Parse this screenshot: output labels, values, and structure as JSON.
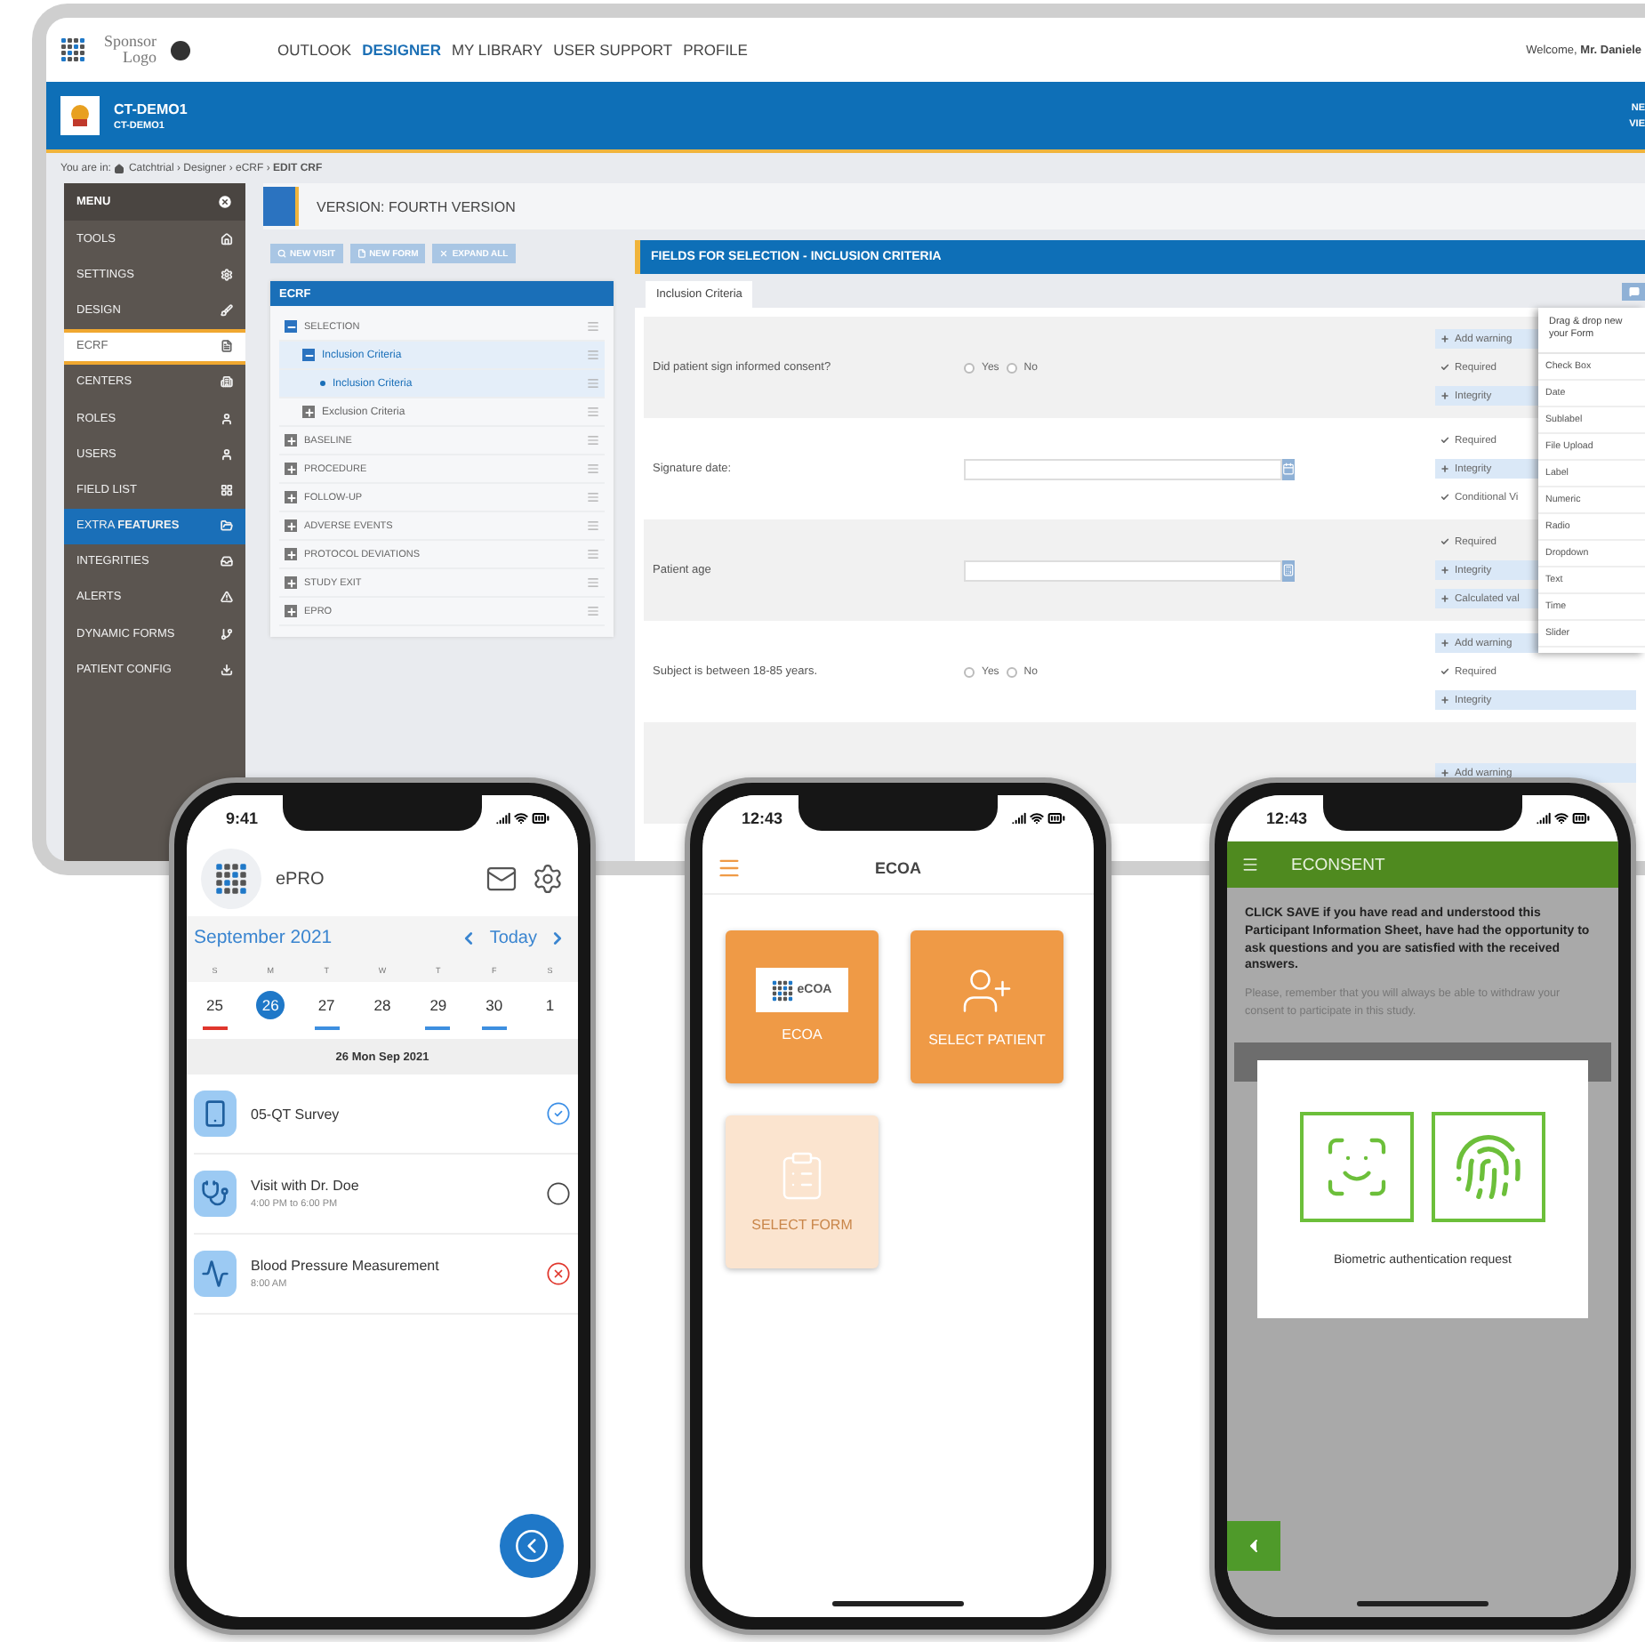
{
  "monitor": {
    "topnav": {
      "logo": "Sponsor Logo",
      "links": [
        {
          "label": "OUTLOOK",
          "selected": false
        },
        {
          "label": "DESIGNER",
          "selected": true
        },
        {
          "label": "MY LIBRARY",
          "selected": false
        },
        {
          "label": "USER SUPPORT",
          "selected": false
        },
        {
          "label": "PROFILE",
          "selected": false
        }
      ],
      "welcome": "Welcome, **Mr. Daniele**"
    },
    "study_bar": {
      "title": "CT-DEMO1",
      "subtitle": "CT-DEMO1",
      "links": [
        "NE",
        "VIE"
      ]
    },
    "breadcrumb": {
      "prefix": "You are in:",
      "path": "Catchtrial › Designer › eCRF › **EDIT CRF**"
    },
    "sidebar": {
      "title": "MENU",
      "items": [
        {
          "label": "TOOLS",
          "selected": false,
          "highlighted": false
        },
        {
          "label": "SETTINGS",
          "selected": false,
          "highlighted": false
        },
        {
          "label": "DESIGN",
          "selected": false,
          "highlighted": false
        },
        {
          "label": "ECRF",
          "selected": true,
          "highlighted": false
        },
        {
          "label": "CENTERS",
          "selected": false,
          "highlighted": false
        },
        {
          "label": "ROLES",
          "selected": false,
          "highlighted": false
        },
        {
          "label": "USERS",
          "selected": false,
          "highlighted": false
        },
        {
          "label": "FIELD LIST",
          "selected": false,
          "highlighted": false
        },
        {
          "label": "EXTRA **FEATURES**",
          "selected": false,
          "highlighted": true
        },
        {
          "label": "INTEGRITIES",
          "selected": false,
          "highlighted": false
        },
        {
          "label": "ALERTS",
          "selected": false,
          "highlighted": false
        },
        {
          "label": "DYNAMIC FORMS",
          "selected": false,
          "highlighted": false
        },
        {
          "label": "PATIENT CONFIG",
          "selected": false,
          "highlighted": false
        }
      ]
    },
    "version": "VERSION: FOURTH VERSION",
    "toolbar": [
      "NEW VISIT",
      "NEW FORM",
      "EXPAND ALL"
    ],
    "tree": {
      "title": "ECRF",
      "nodes": [
        {
          "label": "SELECTION",
          "expanded": true,
          "selected": false,
          "children": [
            {
              "label": "Inclusion Criteria",
              "expanded": true,
              "selected": true,
              "children": [
                {
                  "label": "Inclusion Criteria",
                  "selected": true
                }
              ]
            },
            {
              "label": "Exclusion Criteria",
              "expanded": false,
              "selected": false
            }
          ]
        },
        {
          "label": "BASELINE",
          "expanded": false,
          "selected": false
        },
        {
          "label": "PROCEDURE",
          "expanded": false,
          "selected": false
        },
        {
          "label": "FOLLOW-UP",
          "expanded": false,
          "selected": false
        },
        {
          "label": "ADVERSE EVENTS",
          "expanded": false,
          "selected": false
        },
        {
          "label": "PROTOCOL DEVIATIONS",
          "expanded": false,
          "selected": false
        },
        {
          "label": "STUDY EXIT",
          "expanded": false,
          "selected": false
        },
        {
          "label": "EPRO",
          "expanded": false,
          "selected": false
        }
      ]
    },
    "fields": {
      "title": "FIELDS FOR SELECTION - INCLUSION CRITERIA",
      "tabs": [
        {
          "label": "Inclusion Criteria",
          "selected": true
        }
      ],
      "rows": [
        {
          "label": "Did patient sign informed consent?",
          "control": {
            "kind": "radio",
            "options": [
              {
                "label": "Yes",
                "selected": false
              },
              {
                "label": "No",
                "selected": false
              }
            ]
          },
          "actions": [
            {
              "kind": "add",
              "label": "Add warning"
            },
            {
              "kind": "check",
              "label": "Required"
            },
            {
              "kind": "add",
              "label": "Integrity"
            }
          ]
        },
        {
          "label": "Signature date:",
          "control": {
            "kind": "date"
          },
          "actions": [
            {
              "kind": "check",
              "label": "Required"
            },
            {
              "kind": "add",
              "label": "Integrity"
            },
            {
              "kind": "check",
              "label": "Conditional Vi"
            }
          ]
        },
        {
          "label": "Patient age",
          "control": {
            "kind": "calculated"
          },
          "actions": [
            {
              "kind": "check",
              "label": "Required"
            },
            {
              "kind": "add",
              "label": "Integrity"
            },
            {
              "kind": "add",
              "label": "Calculated val"
            }
          ]
        },
        {
          "label": "Subject is between 18-85 years.",
          "control": {
            "kind": "radio",
            "options": [
              {
                "label": "Yes",
                "selected": false
              },
              {
                "label": "No",
                "selected": false
              }
            ]
          },
          "actions": [
            {
              "kind": "add",
              "label": "Add warning"
            },
            {
              "kind": "check",
              "label": "Required"
            },
            {
              "kind": "add",
              "label": "Integrity"
            }
          ]
        },
        {
          "actions": [
            {
              "kind": "add",
              "label": "Add warning"
            }
          ]
        }
      ]
    },
    "palette": {
      "title": "Drag & drop new your Form",
      "items": [
        "Check Box",
        "Date",
        "Sublabel",
        "File Upload",
        "Label",
        "Numeric",
        "Radio",
        "Dropdown",
        "Text",
        "Time",
        "Slider"
      ]
    }
  },
  "epro_app": {
    "time": "9:41",
    "title": "ePRO",
    "month": "September 2021",
    "today": "Today",
    "weekdays": [
      "S",
      "M",
      "T",
      "W",
      "T",
      "F",
      "S"
    ],
    "days": [
      {
        "day": "25",
        "selected": false,
        "color": "#e0362c"
      },
      {
        "day": "26",
        "selected": true
      },
      {
        "day": "27",
        "selected": false,
        "color": "#3d8fe0"
      },
      {
        "day": "28",
        "selected": false
      },
      {
        "day": "29",
        "selected": false,
        "color": "#3d8fe0"
      },
      {
        "day": "30",
        "selected": false,
        "color": "#3d8fe0"
      },
      {
        "day": "1",
        "selected": false
      }
    ],
    "date_label": "26 Mon Sep 2021",
    "events": [
      {
        "title": "05-QT Survey",
        "kind": "done"
      },
      {
        "title": "Visit with Dr. Doe",
        "time": "4:00 PM to 6:00 PM",
        "kind": "pending"
      },
      {
        "title": "Blood Pressure Measurement",
        "time": "8:00 AM",
        "kind": "missed"
      }
    ]
  },
  "ecoa_app": {
    "time": "12:43",
    "title": "ECOA",
    "tiles": [
      {
        "label": "ECOA",
        "logo_text": "eCOA",
        "disabled": false
      },
      {
        "label": "SELECT PATIENT",
        "disabled": false
      },
      {
        "label": "SELECT FORM",
        "disabled": true
      }
    ]
  },
  "econsent_app": {
    "time": "12:43",
    "title": "ECONSENT",
    "instructions": "CLICK SAVE if you have read and understood this Participant Information Sheet, have had the opportunity to ask questions and you are satisfied with the received answers.",
    "note": "Please, remember that you will always be able to withdraw your consent to participate in this study.",
    "dialog": "Biometric authentication request"
  }
}
